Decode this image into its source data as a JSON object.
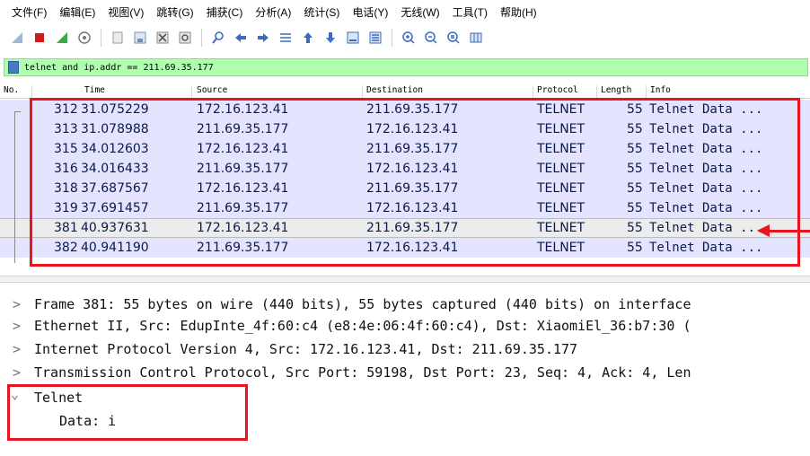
{
  "menu": [
    "文件(F)",
    "编辑(E)",
    "视图(V)",
    "跳转(G)",
    "捕获(C)",
    "分析(A)",
    "统计(S)",
    "电话(Y)",
    "无线(W)",
    "工具(T)",
    "帮助(H)"
  ],
  "toolbar_icons": [
    "shark-fin-icon",
    "stop-icon",
    "restart-icon",
    "options-icon",
    "open-icon",
    "save-icon",
    "close-file-icon",
    "reload-icon",
    "find-icon",
    "back-icon",
    "forward-icon",
    "go-to-icon",
    "first-icon",
    "last-icon",
    "autoscroll-icon",
    "colorize-icon",
    "zoom-in-icon",
    "zoom-out-icon",
    "zoom-reset-icon",
    "resize-columns-icon"
  ],
  "filter": {
    "value": "telnet and ip.addr == 211.69.35.177"
  },
  "columns": {
    "no": "No.",
    "time": "Time",
    "source": "Source",
    "destination": "Destination",
    "protocol": "Protocol",
    "length": "Length",
    "info": "Info"
  },
  "packets": [
    {
      "no": "312",
      "time": "31.075229",
      "source": "172.16.123.41",
      "destination": "211.69.35.177",
      "protocol": "TELNET",
      "length": "55",
      "info": "Telnet Data ..."
    },
    {
      "no": "313",
      "time": "31.078988",
      "source": "211.69.35.177",
      "destination": "172.16.123.41",
      "protocol": "TELNET",
      "length": "55",
      "info": "Telnet Data ..."
    },
    {
      "no": "315",
      "time": "34.012603",
      "source": "172.16.123.41",
      "destination": "211.69.35.177",
      "protocol": "TELNET",
      "length": "55",
      "info": "Telnet Data ..."
    },
    {
      "no": "316",
      "time": "34.016433",
      "source": "211.69.35.177",
      "destination": "172.16.123.41",
      "protocol": "TELNET",
      "length": "55",
      "info": "Telnet Data ..."
    },
    {
      "no": "318",
      "time": "37.687567",
      "source": "172.16.123.41",
      "destination": "211.69.35.177",
      "protocol": "TELNET",
      "length": "55",
      "info": "Telnet Data ..."
    },
    {
      "no": "319",
      "time": "37.691457",
      "source": "211.69.35.177",
      "destination": "172.16.123.41",
      "protocol": "TELNET",
      "length": "55",
      "info": "Telnet Data ..."
    },
    {
      "no": "381",
      "time": "40.937631",
      "source": "172.16.123.41",
      "destination": "211.69.35.177",
      "protocol": "TELNET",
      "length": "55",
      "info": "Telnet Data ..."
    },
    {
      "no": "382",
      "time": "40.941190",
      "source": "211.69.35.177",
      "destination": "172.16.123.41",
      "protocol": "TELNET",
      "length": "55",
      "info": "Telnet Data ..."
    }
  ],
  "selected_packet": "381",
  "details": [
    {
      "caret": ">",
      "text": "Frame 381: 55 bytes on wire (440 bits), 55 bytes captured (440 bits) on interface"
    },
    {
      "caret": ">",
      "text": "Ethernet II, Src: EdupInte_4f:60:c4 (e8:4e:06:4f:60:c4), Dst: XiaomiEl_36:b7:30 ("
    },
    {
      "caret": ">",
      "text": "Internet Protocol Version 4, Src: 172.16.123.41, Dst: 211.69.35.177"
    },
    {
      "caret": ">",
      "text": "Transmission Control Protocol, Src Port: 59198, Dst Port: 23, Seq: 4, Ack: 4, Len"
    },
    {
      "caret": "⌄",
      "text": "Telnet"
    },
    {
      "caret": "",
      "text": "Data: i"
    }
  ],
  "colors": {
    "row_bg": "#e4e4ff",
    "selected_bg": "#ececec",
    "filter_bg": "#afffaf",
    "highlight": "#e8141e"
  }
}
